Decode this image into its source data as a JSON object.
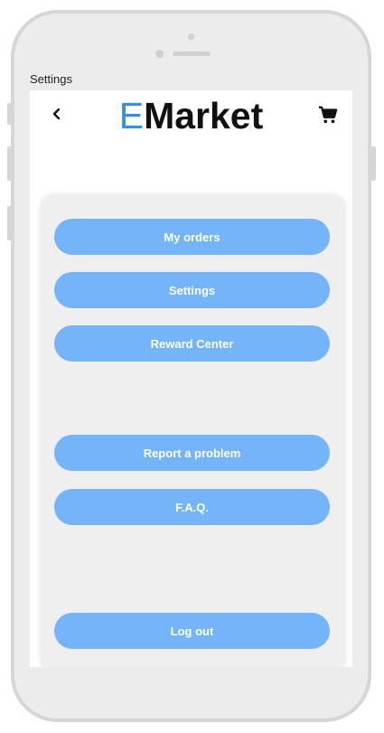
{
  "screen_title": "Settings",
  "header": {
    "logo_accent": "E",
    "logo_rest": "Market",
    "back_icon": "chevron-left-icon",
    "cart_icon": "shopping-cart-icon"
  },
  "menu": {
    "my_orders": "My orders",
    "settings": "Settings",
    "reward_center": "Reward Center",
    "report_problem": "Report a problem",
    "faq": "F.A.Q.",
    "log_out": "Log out"
  },
  "colors": {
    "accent": "#2e8ff0",
    "button_bg": "#74b4f8",
    "button_text": "#ffffff",
    "card_bg": "#efefef"
  }
}
